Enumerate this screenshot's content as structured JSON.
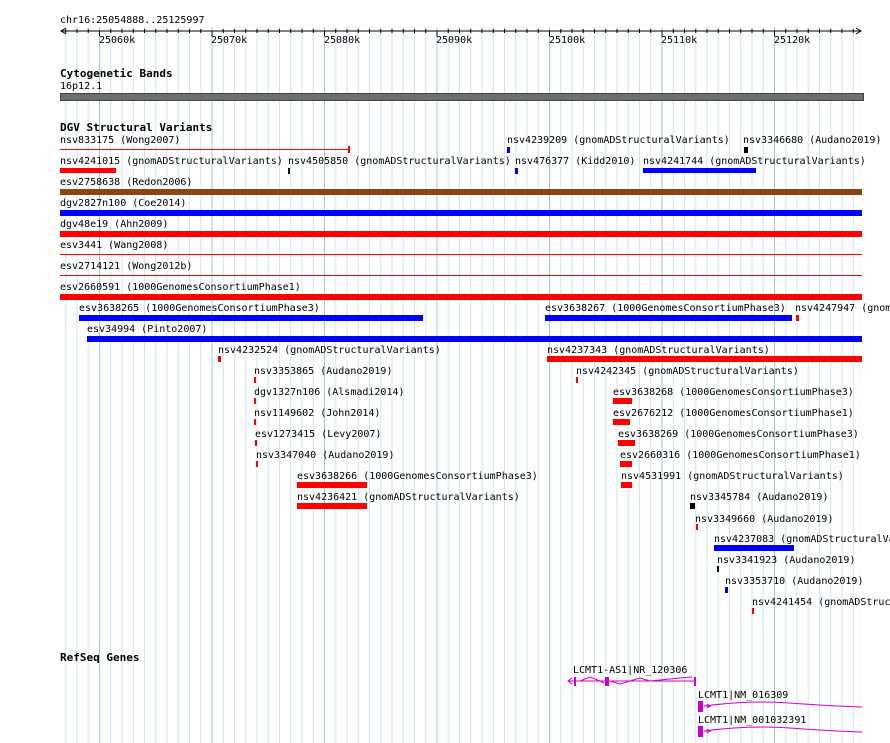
{
  "header": {
    "position": "chr16:25054888..25125997"
  },
  "ruler_ticks": [
    "25060k",
    "25070k",
    "25080k",
    "25090k",
    "25100k",
    "25110k",
    "25120k"
  ],
  "tracks": {
    "cyto": {
      "title": "Cytogenetic Bands",
      "band": "16p12.1",
      "color": "#6e6e6e"
    },
    "dgv": {
      "title": "DGV Structural Variants"
    },
    "refseq": {
      "title": "RefSeq Genes"
    }
  },
  "variants": [
    {
      "label": "nsv833175 (Wong2007)",
      "color": "#ff0000"
    },
    {
      "label": "nsv4239209 (gnomADStructuralVariants)",
      "color": "#0000ff"
    },
    {
      "label": "nsv3346680 (Audano2019)",
      "color": "#000000"
    },
    {
      "label": "nsv4241015 (gnomADStructuralVariants)",
      "color": "#ff0000"
    },
    {
      "label": "nsv4505850 (gnomADStructuralVariants)",
      "color": "#000000"
    },
    {
      "label": "nsv476377 (Kidd2010)",
      "color": "#0000ff"
    },
    {
      "label": "nsv4241744 (gnomADStructuralVariants)",
      "color": "#0000ff"
    },
    {
      "label": "esv2758638 (Redon2006)",
      "color": "#8b4513"
    },
    {
      "label": "dgv2827n100 (Coe2014)",
      "color": "#0000ff"
    },
    {
      "label": "dgv48e19 (Ahn2009)",
      "color": "#ff0000"
    },
    {
      "label": "esv3441 (Wang2008)",
      "color": "#ff0000"
    },
    {
      "label": "esv2714121 (Wong2012b)",
      "color": "#ff0000"
    },
    {
      "label": "esv2660591 (1000GenomesConsortiumPhase1)",
      "color": "#ff0000"
    },
    {
      "label": "esv3638265 (1000GenomesConsortiumPhase3)",
      "color": "#0000ff"
    },
    {
      "label": "esv3638267 (1000GenomesConsortiumPhase3)",
      "color": "#0000ff"
    },
    {
      "label": "nsv4247947 (gnom",
      "color": "#ff0000"
    },
    {
      "label": "esv34994 (Pinto2007)",
      "color": "#0000ff"
    },
    {
      "label": "nsv4232524 (gnomADStructuralVariants)",
      "color": "#ff0000"
    },
    {
      "label": "nsv4237343 (gnomADStructuralVariants)",
      "color": "#ff0000"
    },
    {
      "label": "nsv3353865 (Audano2019)",
      "color": "#ff0000"
    },
    {
      "label": "nsv4242345 (gnomADStructuralVariants)",
      "color": "#ff0000"
    },
    {
      "label": "dgv1327n106 (Alsmadi2014)",
      "color": "#ff0000"
    },
    {
      "label": "esv3638268 (1000GenomesConsortiumPhase3)",
      "color": "#ff0000"
    },
    {
      "label": "nsv1149602 (John2014)",
      "color": "#ff0000"
    },
    {
      "label": "esv2676212 (1000GenomesConsortiumPhase1)",
      "color": "#ff0000"
    },
    {
      "label": "esv1273415 (Levy2007)",
      "color": "#ff0000"
    },
    {
      "label": "esv3638269 (1000GenomesConsortiumPhase3)",
      "color": "#ff0000"
    },
    {
      "label": "nsv3347040 (Audano2019)",
      "color": "#ff0000"
    },
    {
      "label": "esv2660316 (1000GenomesConsortiumPhase1)",
      "color": "#ff0000"
    },
    {
      "label": "esv3638266 (1000GenomesConsortiumPhase3)",
      "color": "#ff0000"
    },
    {
      "label": "nsv4531991 (gnomADStructuralVariants)",
      "color": "#ff0000"
    },
    {
      "label": "nsv4236421 (gnomADStructuralVariants)",
      "color": "#ff0000"
    },
    {
      "label": "nsv3345784 (Audano2019)",
      "color": "#000000"
    },
    {
      "label": "nsv3349660 (Audano2019)",
      "color": "#ff0000"
    },
    {
      "label": "nsv4237083 (gnomADStructuralVa",
      "color": "#0000ff"
    },
    {
      "label": "nsv3341923 (Audano2019)",
      "color": "#000000"
    },
    {
      "label": "nsv3353710 (Audano2019)",
      "color": "#0000ff"
    },
    {
      "label": "nsv4241454 (gnomADStruc",
      "color": "#ff0000"
    }
  ],
  "genes": [
    {
      "label": "LCMT1-AS1|NR_120306",
      "color": "#cc00cc"
    },
    {
      "label": "LCMT1|NM_016309",
      "color": "#cc00cc"
    },
    {
      "label": "LCMT1|NM_001032391",
      "color": "#cc00cc"
    }
  ]
}
